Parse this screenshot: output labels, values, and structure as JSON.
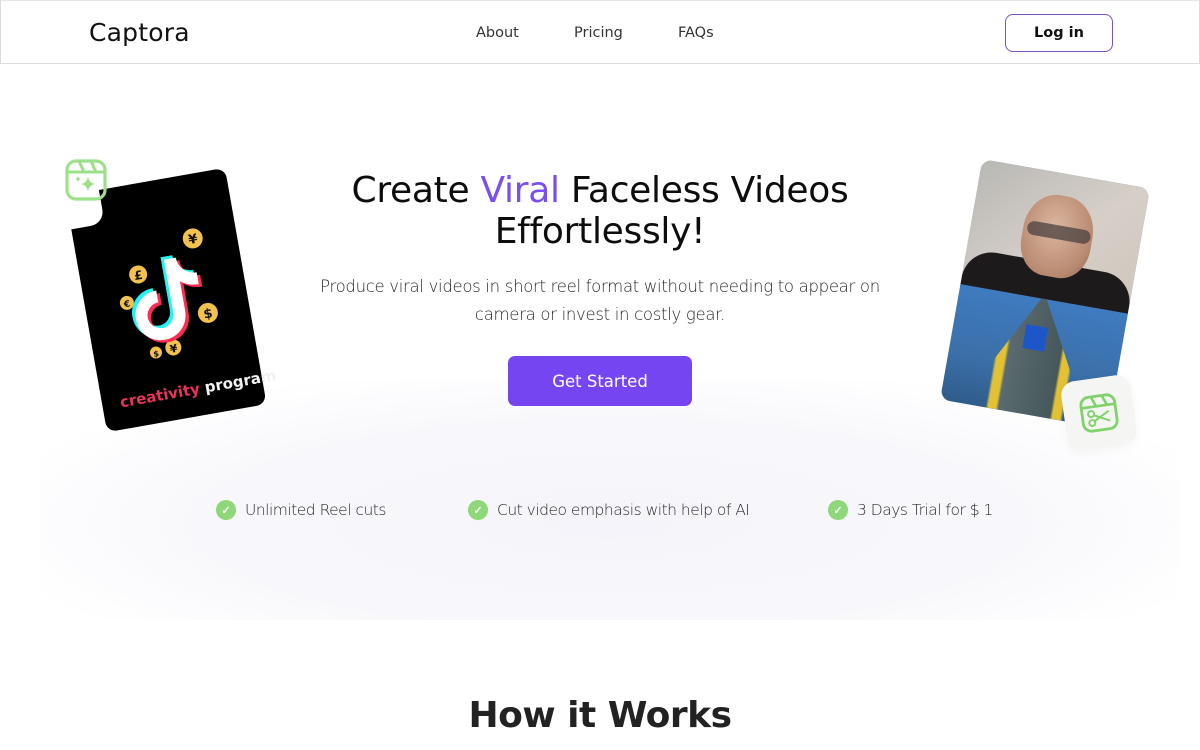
{
  "nav": {
    "brand": "Captora",
    "links": [
      {
        "label": "About"
      },
      {
        "label": "Pricing"
      },
      {
        "label": "FAQs"
      }
    ],
    "login_label": "Log in"
  },
  "hero": {
    "title_pre": "Create ",
    "title_accent": "Viral",
    "title_post": " Faceless Videos Effortlessly!",
    "subtitle": "Produce viral videos in short reel format without needing to appear on camera or invest in costly gear.",
    "cta_label": "Get Started",
    "accent_color": "#7645f2",
    "left_card": {
      "label_part1": "creativity",
      "label_part2": " program",
      "logo": "tiktok-logo",
      "badge_icon": "reel-sparkle-icon",
      "coin_symbols": [
        "¥",
        "£",
        "€",
        "$",
        "$",
        "¥"
      ]
    },
    "right_card": {
      "badge_icon": "reel-scissors-icon"
    }
  },
  "features": [
    {
      "icon": "check-circle-icon",
      "label": "Unlimited Reel cuts"
    },
    {
      "icon": "check-circle-icon",
      "label": "Cut video emphasis with help of AI"
    },
    {
      "icon": "check-circle-icon",
      "label": "3 Days Trial for $ 1"
    }
  ],
  "how_it_works": {
    "title": "How it Works"
  }
}
